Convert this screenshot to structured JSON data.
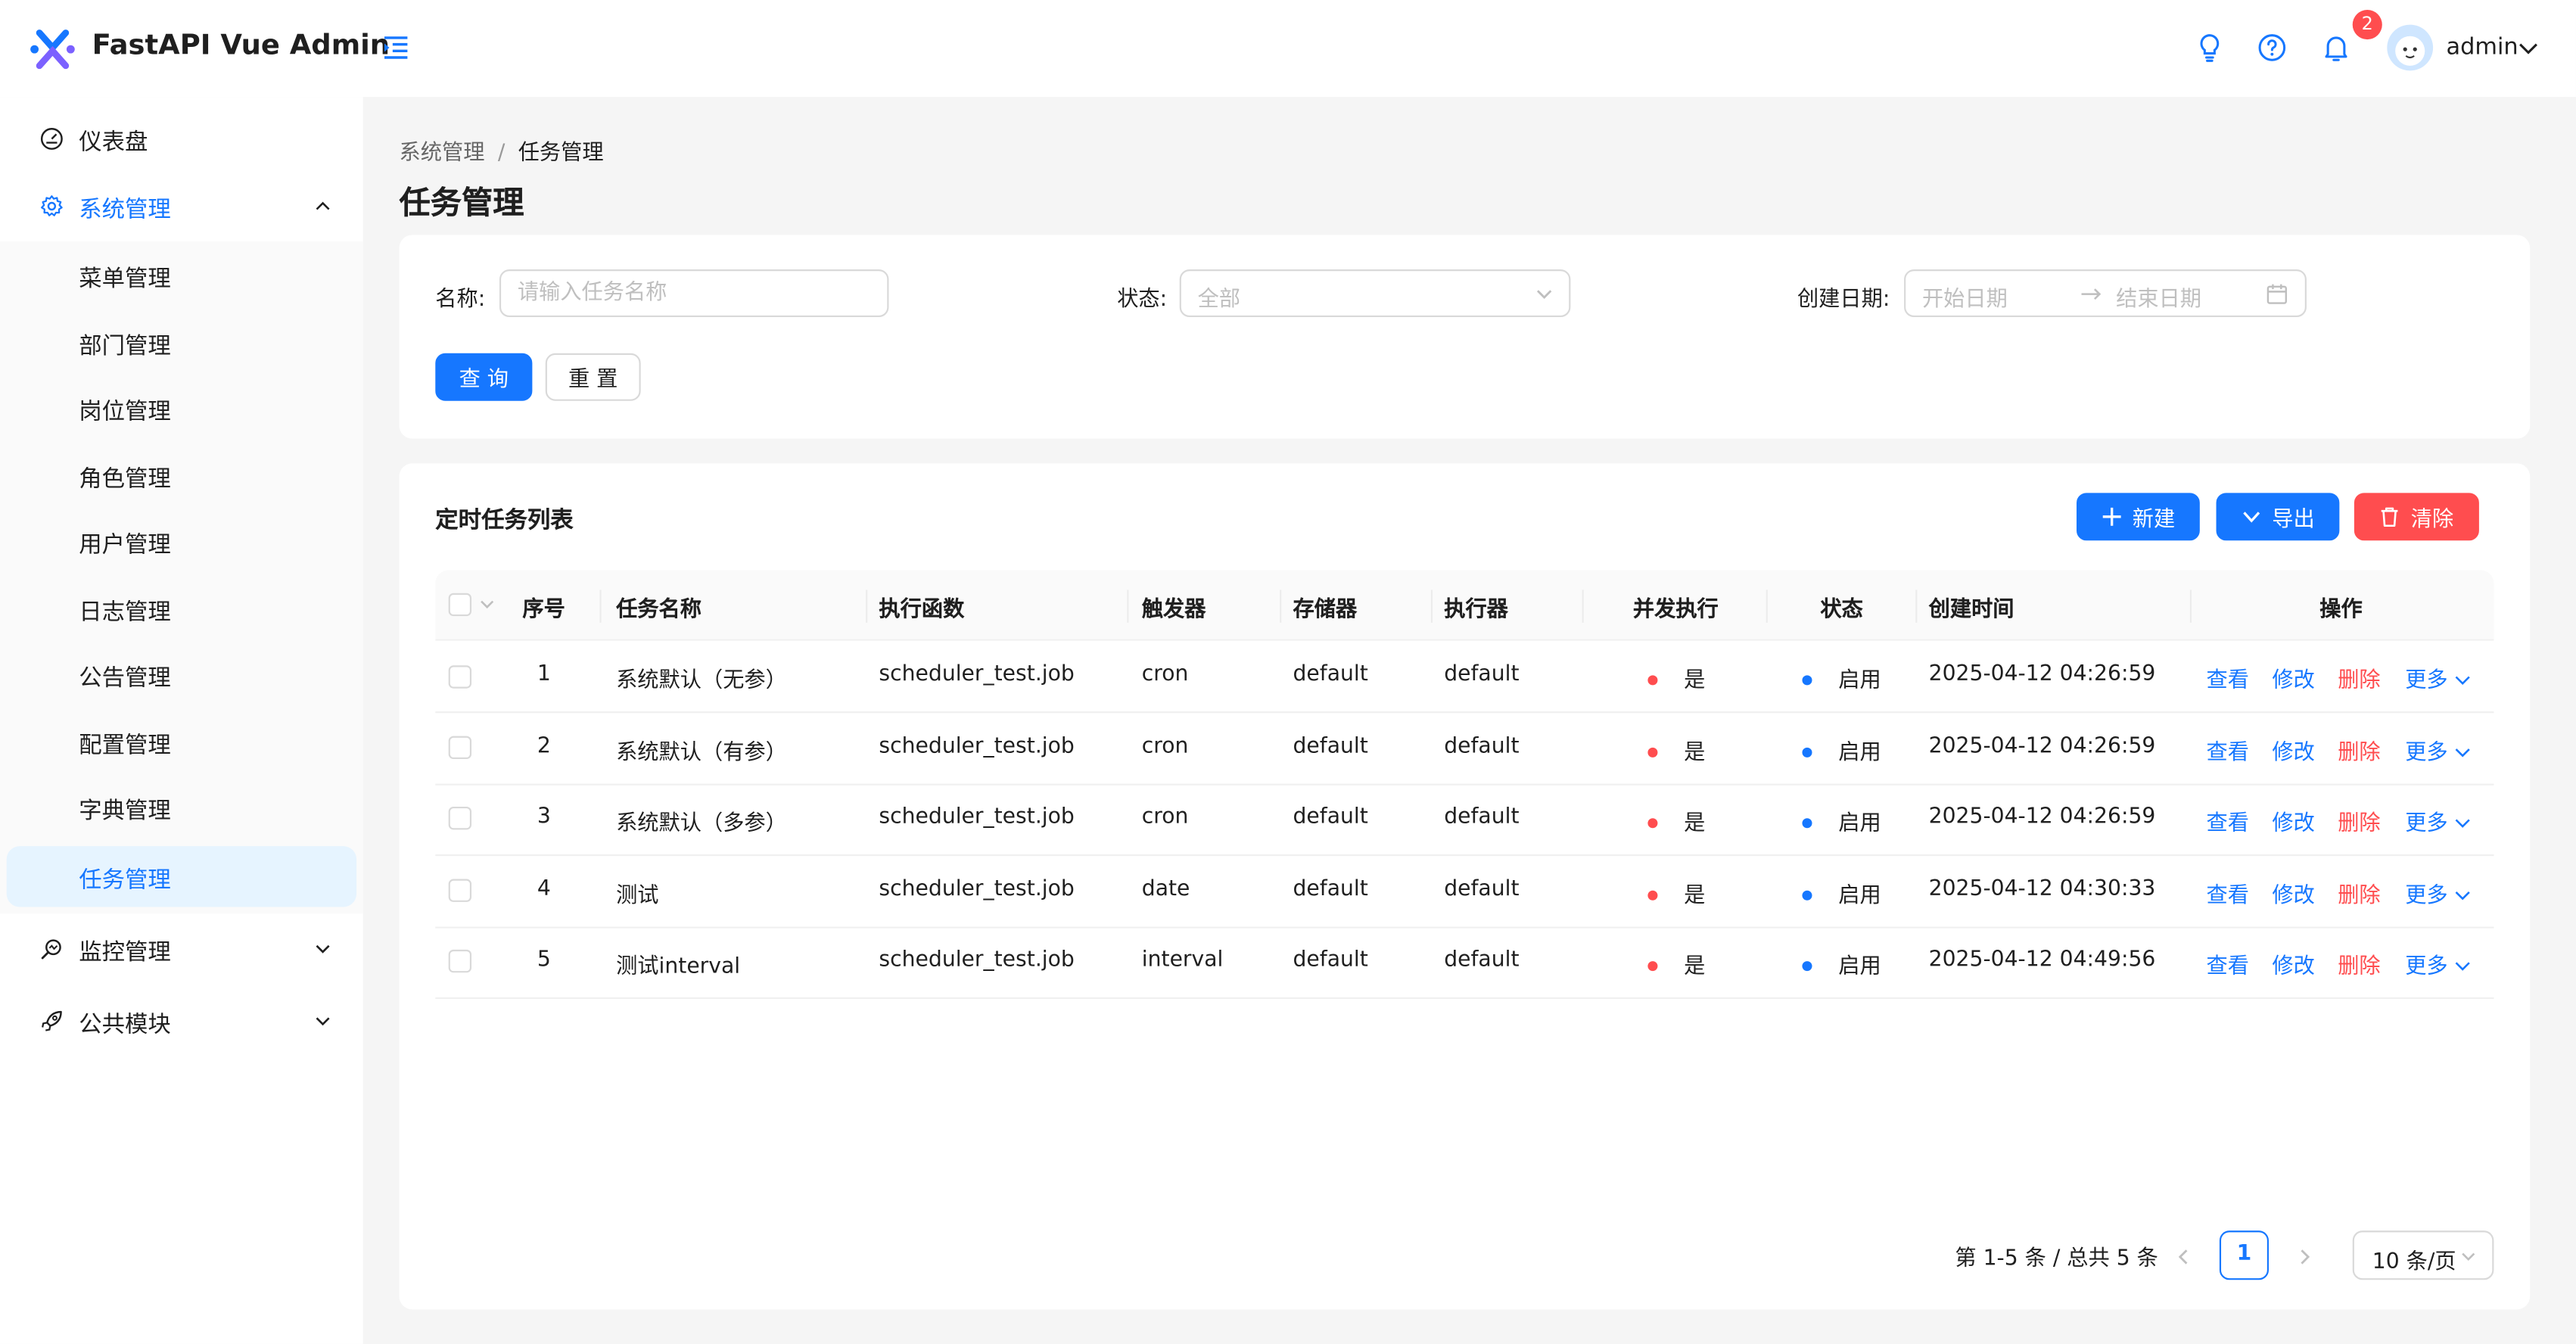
{
  "app": {
    "title": "FastAPI Vue Admin"
  },
  "header": {
    "notification_count": "2",
    "user": "admin"
  },
  "sidebar": {
    "items": [
      {
        "label": "仪表盘",
        "icon": "dashboard-icon"
      },
      {
        "label": "系统管理",
        "icon": "gear-icon",
        "expanded": true
      },
      {
        "label": "监控管理",
        "icon": "monitor-icon"
      },
      {
        "label": "公共模块",
        "icon": "rocket-icon"
      }
    ],
    "sub_items": [
      "菜单管理",
      "部门管理",
      "岗位管理",
      "角色管理",
      "用户管理",
      "日志管理",
      "公告管理",
      "配置管理",
      "字典管理",
      "任务管理"
    ],
    "selected": "任务管理"
  },
  "breadcrumb": {
    "parent": "系统管理",
    "separator": "/",
    "current": "任务管理"
  },
  "page_title": "任务管理",
  "search": {
    "name_label": "名称:",
    "name_placeholder": "请输入任务名称",
    "status_label": "状态:",
    "status_placeholder": "全部",
    "date_label": "创建日期:",
    "start_placeholder": "开始日期",
    "end_placeholder": "结束日期",
    "query_label": "查 询",
    "reset_label": "重 置"
  },
  "table": {
    "title": "定时任务列表",
    "new_label": "新建",
    "export_label": "导出",
    "clear_label": "清除",
    "columns": [
      "序号",
      "任务名称",
      "执行函数",
      "触发器",
      "存储器",
      "执行器",
      "并发执行",
      "状态",
      "创建时间",
      "操作"
    ],
    "rows": [
      {
        "no": "1",
        "name": "系统默认（无参）",
        "func": "scheduler_test.job",
        "trigger": "cron",
        "store": "default",
        "executor": "default",
        "concurrent": "是",
        "status": "启用",
        "created": "2025-04-12 04:26:59"
      },
      {
        "no": "2",
        "name": "系统默认（有参）",
        "func": "scheduler_test.job",
        "trigger": "cron",
        "store": "default",
        "executor": "default",
        "concurrent": "是",
        "status": "启用",
        "created": "2025-04-12 04:26:59"
      },
      {
        "no": "3",
        "name": "系统默认（多参）",
        "func": "scheduler_test.job",
        "trigger": "cron",
        "store": "default",
        "executor": "default",
        "concurrent": "是",
        "status": "启用",
        "created": "2025-04-12 04:26:59"
      },
      {
        "no": "4",
        "name": "测试",
        "func": "scheduler_test.job",
        "trigger": "date",
        "store": "default",
        "executor": "default",
        "concurrent": "是",
        "status": "启用",
        "created": "2025-04-12 04:30:33"
      },
      {
        "no": "5",
        "name": "测试interval",
        "func": "scheduler_test.job",
        "trigger": "interval",
        "store": "default",
        "executor": "default",
        "concurrent": "是",
        "status": "启用",
        "created": "2025-04-12 04:49:56"
      }
    ],
    "actions": {
      "view": "查看",
      "edit": "修改",
      "delete": "删除",
      "more": "更多"
    }
  },
  "pagination": {
    "total_text": "第 1-5 条 / 总共 5 条",
    "current_page": "1",
    "page_size": "10 条/页"
  },
  "colors": {
    "primary": "#1677ff",
    "danger": "#ff4d4f",
    "concurrent_dot": "#ff4d4f",
    "status_dot": "#1677ff"
  }
}
